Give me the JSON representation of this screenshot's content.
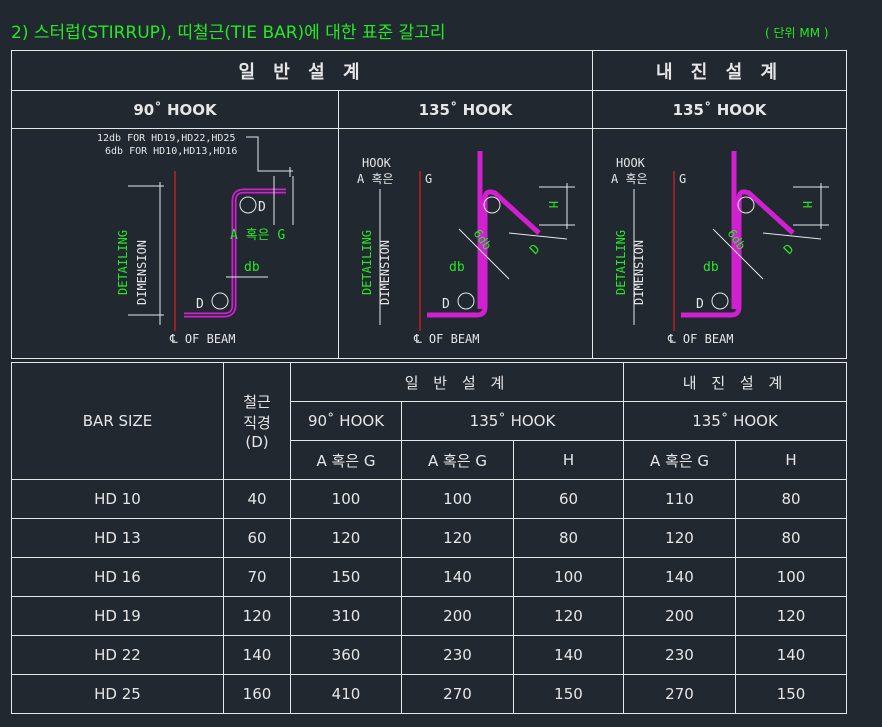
{
  "title": "2) 스터럽(STIRRUP), 띠철근(TIE BAR)에 대한 표준 갈고리",
  "unit": "( 단위  MM )",
  "top_table": {
    "general_design": "일 반 설 계",
    "seismic_design": "내 진 설 계",
    "hook_90": "90˚ HOOK",
    "hook_135_a": "135˚ HOOK",
    "hook_135_b": "135˚ HOOK",
    "drawing1": {
      "note_line1": "12db FOR HD19,HD22,HD25",
      "note_line2": "6db FOR HD10,HD13,HD16",
      "label_D_top": "D",
      "label_AG": "A 혹은 G",
      "label_db": "db",
      "label_D_bottom": "D",
      "label_detailing": "DETAILING",
      "label_dimension": "DIMENSION",
      "label_beam": "℄  OF BEAM"
    },
    "drawing2": {
      "hook_line1": "HOOK",
      "hook_line2": "A  혹은",
      "label_G": "G",
      "label_6db": "6db",
      "label_D": "D",
      "label_H": "H",
      "label_db": "db",
      "label_D_bottom": "D",
      "label_detailing": "DETAILING",
      "label_dimension": "DIMENSION",
      "label_beam": "℄  OF BEAM"
    },
    "drawing3": {
      "hook_line1": "HOOK",
      "hook_line2": "A  혹은",
      "label_G": "G",
      "label_6db": "6db",
      "label_D": "D",
      "label_H": "H",
      "label_db": "db",
      "label_D_bottom": "D",
      "label_detailing": "DETAILING",
      "label_dimension": "DIMENSION",
      "label_beam": "℄  OF BEAM"
    }
  },
  "bottom_table": {
    "bar_size": "BAR    SIZE",
    "diameter_line1": "철근",
    "diameter_line2": "직경",
    "diameter_line3": "(D)",
    "general_design": "일 반 설 계",
    "seismic_design": "내 진 설 계",
    "hook_90": "90˚ HOOK",
    "hook_135_a": "135˚ HOOK",
    "hook_135_b": "135˚ HOOK",
    "col_ag1": "A 혹은 G",
    "col_ag2": "A 혹은 G",
    "col_h1": "H",
    "col_ag3": "A 혹은 G",
    "col_h2": "H",
    "rows": [
      {
        "size": "HD 10",
        "d": "40",
        "g90": "100",
        "g135": "100",
        "h135": "60",
        "s135": "110",
        "sh": "80"
      },
      {
        "size": "HD 13",
        "d": "60",
        "g90": "120",
        "g135": "120",
        "h135": "80",
        "s135": "120",
        "sh": "80"
      },
      {
        "size": "HD 16",
        "d": "70",
        "g90": "150",
        "g135": "140",
        "h135": "100",
        "s135": "140",
        "sh": "100"
      },
      {
        "size": "HD 19",
        "d": "120",
        "g90": "310",
        "g135": "200",
        "h135": "120",
        "s135": "200",
        "sh": "120"
      },
      {
        "size": "HD 22",
        "d": "140",
        "g90": "360",
        "g135": "230",
        "h135": "140",
        "s135": "230",
        "sh": "140"
      },
      {
        "size": "HD 25",
        "d": "160",
        "g90": "410",
        "g135": "270",
        "h135": "150",
        "s135": "270",
        "sh": "150"
      }
    ]
  },
  "colors": {
    "background": "#212830",
    "green": "#27e827",
    "rebar": "#d020d0",
    "centerline": "#e02020",
    "lines": "#e6e6e6"
  }
}
